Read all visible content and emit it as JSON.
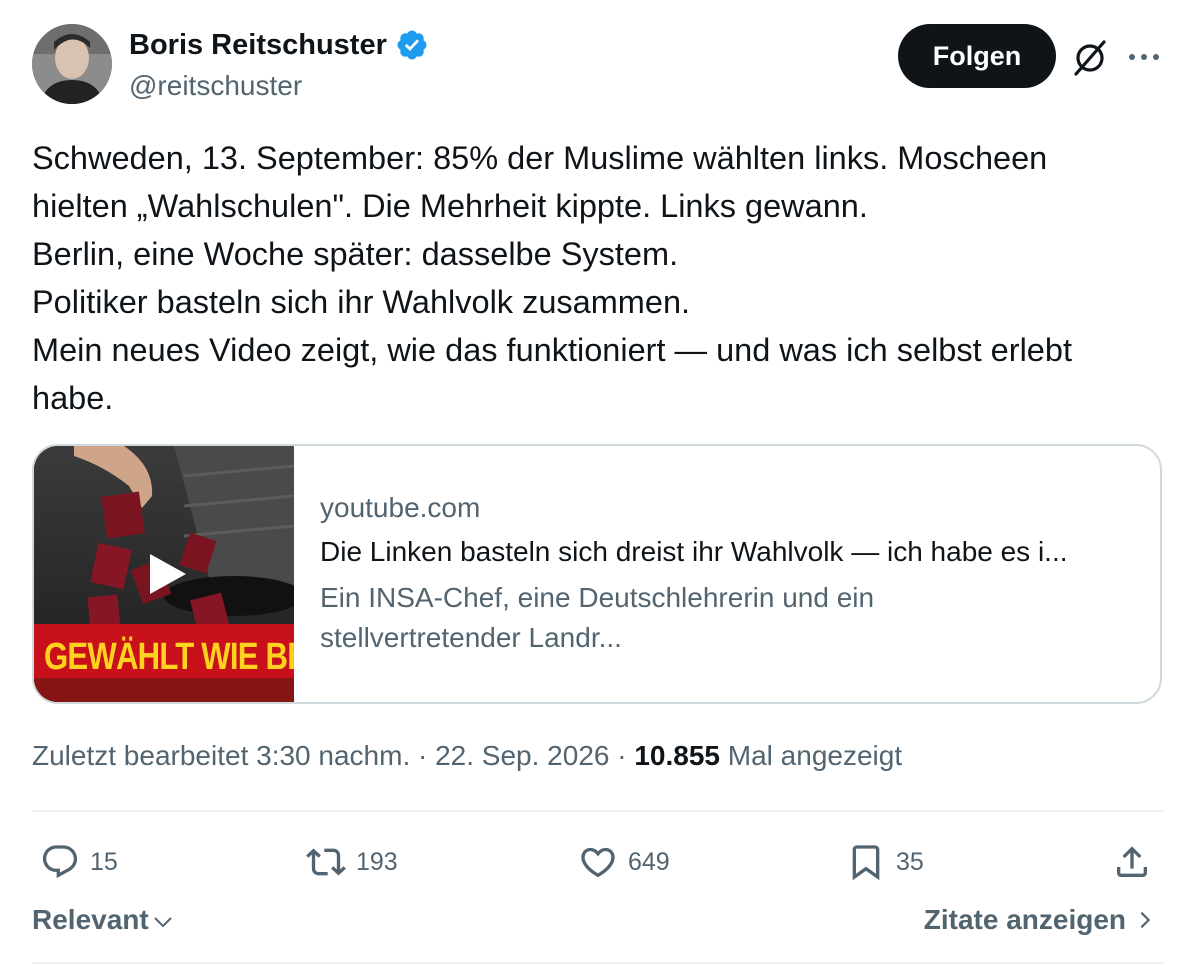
{
  "author": {
    "name": "Boris Reitschuster",
    "handle": "@reitschuster"
  },
  "header": {
    "follow_label": "Folgen"
  },
  "tweet": {
    "lines": [
      "Schweden, 13. September: 85% der Muslime wählten links. Moscheen",
      "hielten „Wahlschulen\". Die Mehrheit kippte. Links gewann.",
      "Berlin, eine Woche später: dasselbe System.",
      "Politiker basteln sich ihr Wahlvolk zusammen.",
      "Mein neues Video zeigt, wie das funktioniert — und was ich selbst erlebt",
      "habe."
    ]
  },
  "card": {
    "thumbnail_banner": "GEWÄHLT WIE BES",
    "domain": "youtube.com",
    "title": "Die Linken basteln sich dreist ihr Wahlvolk — ich habe es i...",
    "description_line1": "Ein INSA-Chef, eine Deutschlehrerin und ein",
    "description_line2": "stellvertretender Landr..."
  },
  "meta": {
    "edited_prefix": "Zuletzt bearbeitet 3:30 nachm. · 22. Sep. 2026 · ",
    "views_count": "10.855",
    "views_suffix": " Mal angezeigt"
  },
  "actions": {
    "replies": "15",
    "reposts": "193",
    "likes": "649",
    "bookmarks": "35"
  },
  "footer": {
    "sort_label": "Relevant",
    "quotes_label": "Zitate anzeigen"
  },
  "colors": {
    "text": "#0f1419",
    "secondary": "#536471",
    "verified": "#1d9bf0",
    "border": "#cfd9de",
    "banner_red": "#c8101a",
    "banner_yellow": "#ffd21f"
  }
}
